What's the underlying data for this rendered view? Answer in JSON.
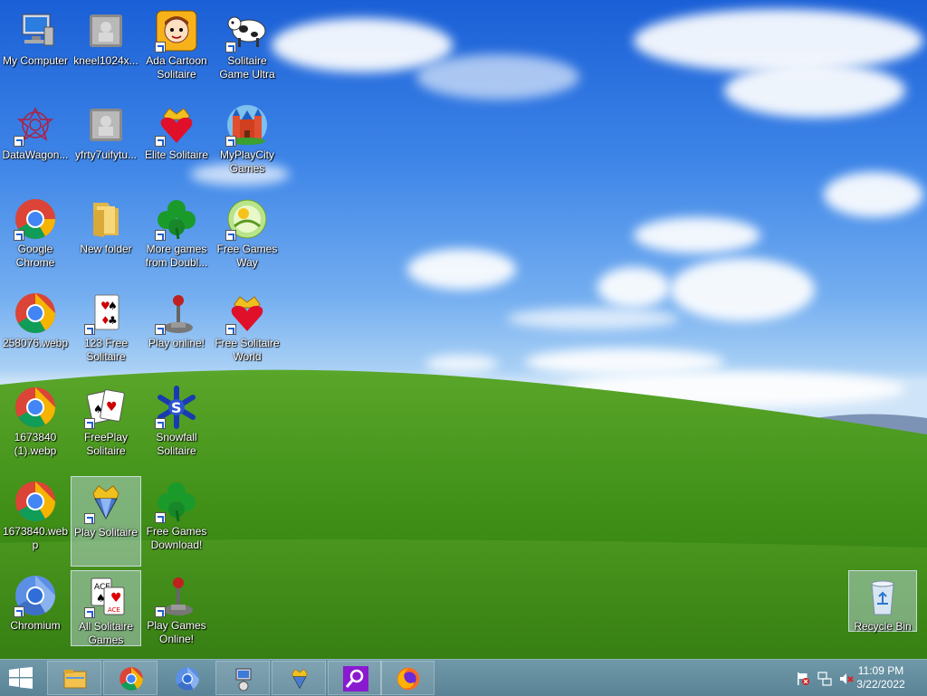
{
  "desktop": {
    "icons": [
      {
        "label": "My Computer",
        "icon": "my-computer-icon"
      },
      {
        "label": "kneel1024x...",
        "icon": "image-file-icon"
      },
      {
        "label": "Ada Cartoon Solitaire",
        "icon": "ada-cartoon-icon"
      },
      {
        "label": "Solitaire Game Ultra",
        "icon": "cow-icon"
      },
      {
        "label": "DataWagon...",
        "icon": "datawagon-icon"
      },
      {
        "label": "yfrty7uifytu...",
        "icon": "image-file-icon"
      },
      {
        "label": "Elite Solitaire",
        "icon": "crown-heart-icon"
      },
      {
        "label": "MyPlayCity Games",
        "icon": "castle-icon"
      },
      {
        "label": "Google Chrome",
        "icon": "chrome-icon"
      },
      {
        "label": "New folder",
        "icon": "folder-icon"
      },
      {
        "label": "More games from Doubl...",
        "icon": "clover-icon"
      },
      {
        "label": "Free Games Way",
        "icon": "free-games-way-icon"
      },
      {
        "label": "258076.webp",
        "icon": "chrome-icon"
      },
      {
        "label": "123 Free Solitaire",
        "icon": "cards-icon"
      },
      {
        "label": "Play online!",
        "icon": "joystick-icon"
      },
      {
        "label": "Free Solitaire World",
        "icon": "crown-heart-icon"
      },
      {
        "label": "1673840 (1).webp",
        "icon": "chrome-icon"
      },
      {
        "label": "FreePlay Solitaire",
        "icon": "playing-cards-icon"
      },
      {
        "label": "Snowfall Solitaire",
        "icon": "snowflake-icon"
      },
      {
        "label": "1673840.webp",
        "icon": "chrome-icon"
      },
      {
        "label": "Play Solitaire",
        "icon": "crown-diamond-icon"
      },
      {
        "label": "Free Games Download!",
        "icon": "clover-icon"
      },
      {
        "label": "Chromium",
        "icon": "chromium-icon"
      },
      {
        "label": "All Solitaire Games",
        "icon": "ace-cards-icon"
      },
      {
        "label": "Play Games Online!",
        "icon": "joystick-icon"
      },
      {
        "label": "Recycle Bin",
        "icon": "recycle-bin-icon"
      }
    ]
  },
  "taskbar": {
    "start": "windows-start-icon",
    "pinned": [
      "file-explorer-icon",
      "chrome-icon",
      "chromium-icon",
      "network-app-icon",
      "crown-diamond-icon",
      "search-app-icon",
      "firefox-icon"
    ],
    "clock_time": "11:09 PM",
    "clock_date": "3/22/2022",
    "tray": [
      "flag-icon",
      "network-icon",
      "volume-muted-icon"
    ]
  },
  "colors": {
    "sky_top": "#1a5fd6",
    "grass": "#4c9a1e",
    "taskbar": "#5f8a9c"
  }
}
